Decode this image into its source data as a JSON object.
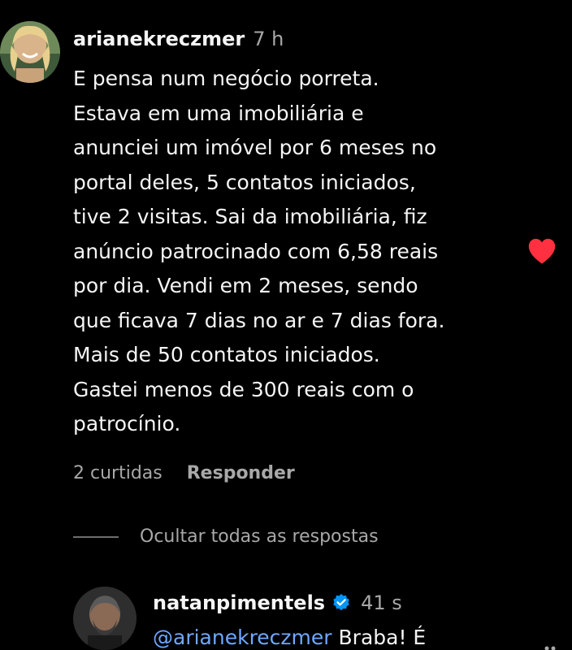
{
  "comment": {
    "username": "arianekreczmer",
    "time": "7 h",
    "text": "E pensa num negócio porreta.\nEstava em uma imobiliária e\nanunciei um imóvel por 6 meses no\nportal deles, 5 contatos iniciados,\ntive 2 visitas. Sai da imobiliária, fiz\nanúncio patrocinado com 6,58 reais\npor dia. Vendi em 2 meses, sendo\nque ficava 7 dias no ar e 7 dias fora.\nMais de 50 contatos iniciados.\nGastei menos de 300 reais com o\npatrocínio.",
    "likes": "2 curtidas",
    "reply_label": "Responder",
    "liked": true
  },
  "replies_toggle": {
    "label": "Ocultar todas as respostas"
  },
  "reply": {
    "username": "natanpimentels",
    "verified": true,
    "time": "41 s",
    "mention": "@arianekreczmer",
    "text": " Braba! É"
  },
  "colors": {
    "background": "#000000",
    "text": "#f5f5f5",
    "secondary": "#a8a8a8",
    "heart": "#ff3040",
    "verified": "#0095f6",
    "mention": "#6fa8ff"
  }
}
